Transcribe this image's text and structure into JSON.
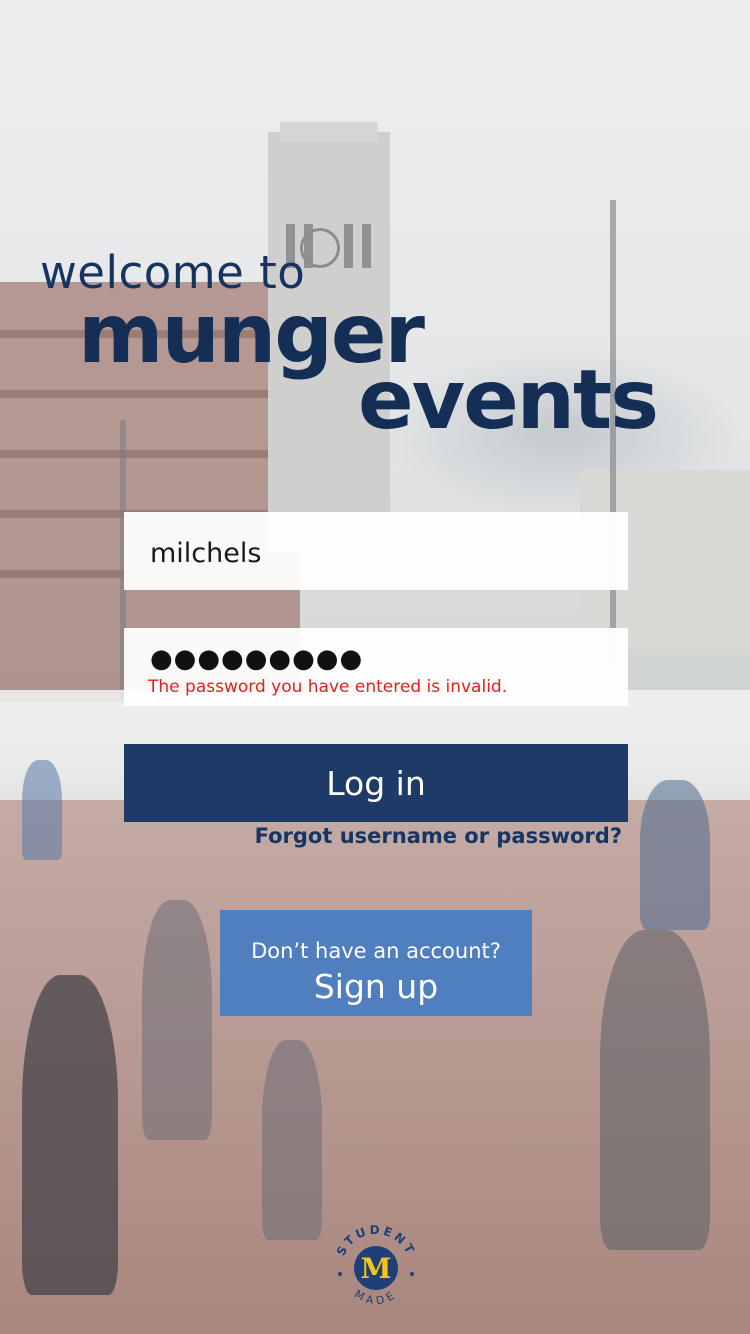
{
  "header": {
    "welcome": "welcome to",
    "title_line1": "munger",
    "title_line2": "events"
  },
  "login_form": {
    "username_value": "milchels",
    "password_mask": "●●●●●●●●●",
    "error_message": "The password you have entered is invalid.",
    "login_label": "Log in",
    "forgot_label": "Forgot username or password?"
  },
  "signup": {
    "prompt": "Don’t have an account?",
    "label": "Sign up"
  },
  "logo": {
    "top_text": "STUDENT",
    "bottom_text": "MADE",
    "letter": "M"
  },
  "colors": {
    "navy": "#1e3a66",
    "title_navy": "#142e55",
    "signup_blue": "#4f7fbe",
    "error_red": "#e0221b",
    "maize": "#f5c518"
  }
}
